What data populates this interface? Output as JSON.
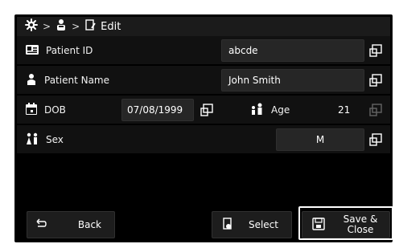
{
  "breadcrumb": {
    "items": [
      "gear-icon",
      "patient-icon",
      "edit-icon"
    ],
    "current_label": "Edit"
  },
  "rows": [
    {
      "id": "patient_id",
      "label": "Patient ID",
      "value": "abcde"
    },
    {
      "id": "patient_name",
      "label": "Patient Name",
      "value": "John Smith"
    },
    {
      "id": "dob",
      "label": "DOB",
      "value": "07/08/1999"
    },
    {
      "id": "age",
      "label": "Age",
      "value": "21"
    },
    {
      "id": "sex",
      "label": "Sex",
      "value": "M"
    }
  ],
  "buttons": {
    "back_label": "Back",
    "select_label": "Select",
    "save_label": "Save & Close"
  }
}
